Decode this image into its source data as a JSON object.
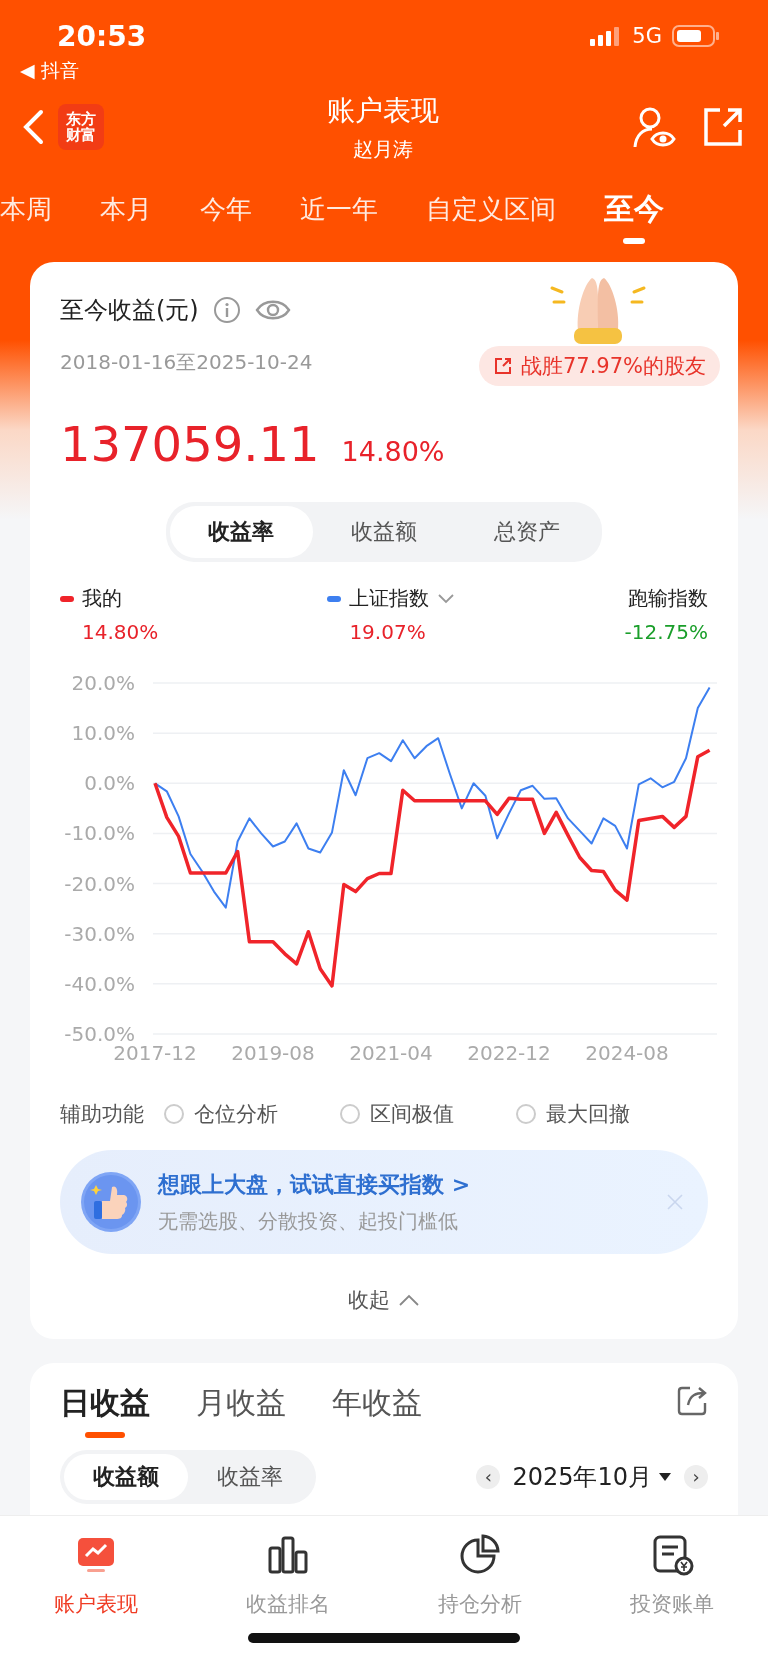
{
  "status_bar": {
    "time": "20:53",
    "back_app": "◀ 抖音",
    "network": "5G"
  },
  "nav": {
    "logo_text": "东方财富",
    "title": "账户表现",
    "subtitle": "赵月涛"
  },
  "period_tabs": [
    {
      "label": "本周",
      "selected": false
    },
    {
      "label": "本月",
      "selected": false
    },
    {
      "label": "今年",
      "selected": false
    },
    {
      "label": "近一年",
      "selected": false
    },
    {
      "label": "自定义区间",
      "selected": false
    },
    {
      "label": "至今",
      "selected": true
    }
  ],
  "summary": {
    "title": "至今收益(元)",
    "date_range": "2018-01-16至2025-10-24",
    "rank_badge": "战胜77.97%的股友",
    "amount": "137059.11",
    "rate": "14.80%"
  },
  "view_tabs": [
    {
      "label": "收益率",
      "selected": true
    },
    {
      "label": "收益额",
      "selected": false
    },
    {
      "label": "总资产",
      "selected": false
    }
  ],
  "legend": [
    {
      "kind": "series",
      "label": "我的",
      "value": "14.80%",
      "color": "#f0242a",
      "dropdown": false
    },
    {
      "kind": "series",
      "label": "上证指数",
      "value": "19.07%",
      "color": "#3d7ff0",
      "dropdown": true
    },
    {
      "kind": "difference",
      "label": "跑输指数",
      "value": "-12.75%",
      "dropdown": false
    }
  ],
  "chart": {
    "chart_data": {
      "type": "line",
      "grid": true,
      "categories": [
        "2017-12",
        null,
        null,
        null,
        null,
        null,
        null,
        null,
        null,
        null,
        "2019-08",
        null,
        null,
        null,
        null,
        null,
        null,
        null,
        null,
        null,
        "2021-04",
        null,
        null,
        null,
        null,
        null,
        null,
        null,
        null,
        null,
        "2022-12",
        null,
        null,
        null,
        null,
        null,
        null,
        null,
        null,
        null,
        "2024-08",
        null,
        null,
        null,
        null,
        null,
        null,
        null
      ],
      "ylim": [
        -50,
        20
      ],
      "yticks": [
        {
          "value": 20,
          "label": "20.0%"
        },
        {
          "value": 10,
          "label": "10.0%"
        },
        {
          "value": 0,
          "label": "0.0%"
        },
        {
          "value": -10,
          "label": "-10.0%"
        },
        {
          "value": -20,
          "label": "-20.0%"
        },
        {
          "value": -30,
          "label": "-30.0%"
        },
        {
          "value": -40,
          "label": "-40.0%"
        },
        {
          "value": -50,
          "label": "-50.0%"
        }
      ],
      "series": [
        {
          "color": "#3d7ff0",
          "values": [
            0,
            -1.6,
            -6.6,
            -14.1,
            -17.6,
            -21.6,
            -24.8,
            -11.6,
            -7,
            -10,
            -12.6,
            -11.6,
            -8,
            -13,
            -13.8,
            -9.8,
            2.6,
            -2.4,
            5,
            6,
            4.4,
            8.6,
            5,
            7.4,
            9,
            1.8,
            -5,
            0,
            -2.5,
            -11,
            -6,
            -1.4,
            -0.5,
            -3.1,
            -3,
            -7,
            -9.5,
            -12,
            -7,
            -8.5,
            -13,
            -0.2,
            1,
            -0.8,
            0.3,
            5,
            15,
            19.1
          ]
        },
        {
          "color": "#f0242a",
          "values": [
            0,
            -6.8,
            -10.6,
            -17.9,
            -17.9,
            -17.9,
            -17.9,
            -13.6,
            -31.6,
            -31.6,
            -31.6,
            -34,
            -36,
            -29.6,
            -37,
            -40.4,
            -20.2,
            -21.6,
            -19,
            -18,
            -18,
            -1.4,
            -3.5,
            -3.5,
            -3.5,
            -3.5,
            -3.5,
            -3.5,
            -3.5,
            -6.2,
            -3,
            -3.2,
            -3.2,
            -10,
            -5.8,
            -10.4,
            -14.8,
            -17.4,
            -17.6,
            -21.3,
            -23.3,
            -7.4,
            -7,
            -6.6,
            -8.8,
            -6.6,
            5.3,
            6.6
          ]
        }
      ]
    }
  },
  "aux": {
    "label": "辅助功能",
    "options": [
      {
        "label": "仓位分析",
        "checked": false
      },
      {
        "label": "区间极值",
        "checked": false
      },
      {
        "label": "最大回撤",
        "checked": false
      }
    ]
  },
  "promo": {
    "title": "想跟上大盘，试试直接买指数 >",
    "subtitle": "无需选股、分散投资、起投门槛低"
  },
  "collapse": "收起",
  "daily": {
    "tabs": [
      {
        "label": "日收益",
        "selected": true
      },
      {
        "label": "月收益",
        "selected": false
      },
      {
        "label": "年收益",
        "selected": false
      }
    ],
    "segments": [
      {
        "label": "收益额",
        "selected": true
      },
      {
        "label": "收益率",
        "selected": false
      }
    ],
    "prev": "‹",
    "month": "2025年10月",
    "next": "›"
  },
  "bottom_nav": [
    {
      "label": "账户表现",
      "selected": true
    },
    {
      "label": "收益排名",
      "selected": false
    },
    {
      "label": "持仓分析",
      "selected": false
    },
    {
      "label": "投资账单",
      "selected": false
    }
  ]
}
